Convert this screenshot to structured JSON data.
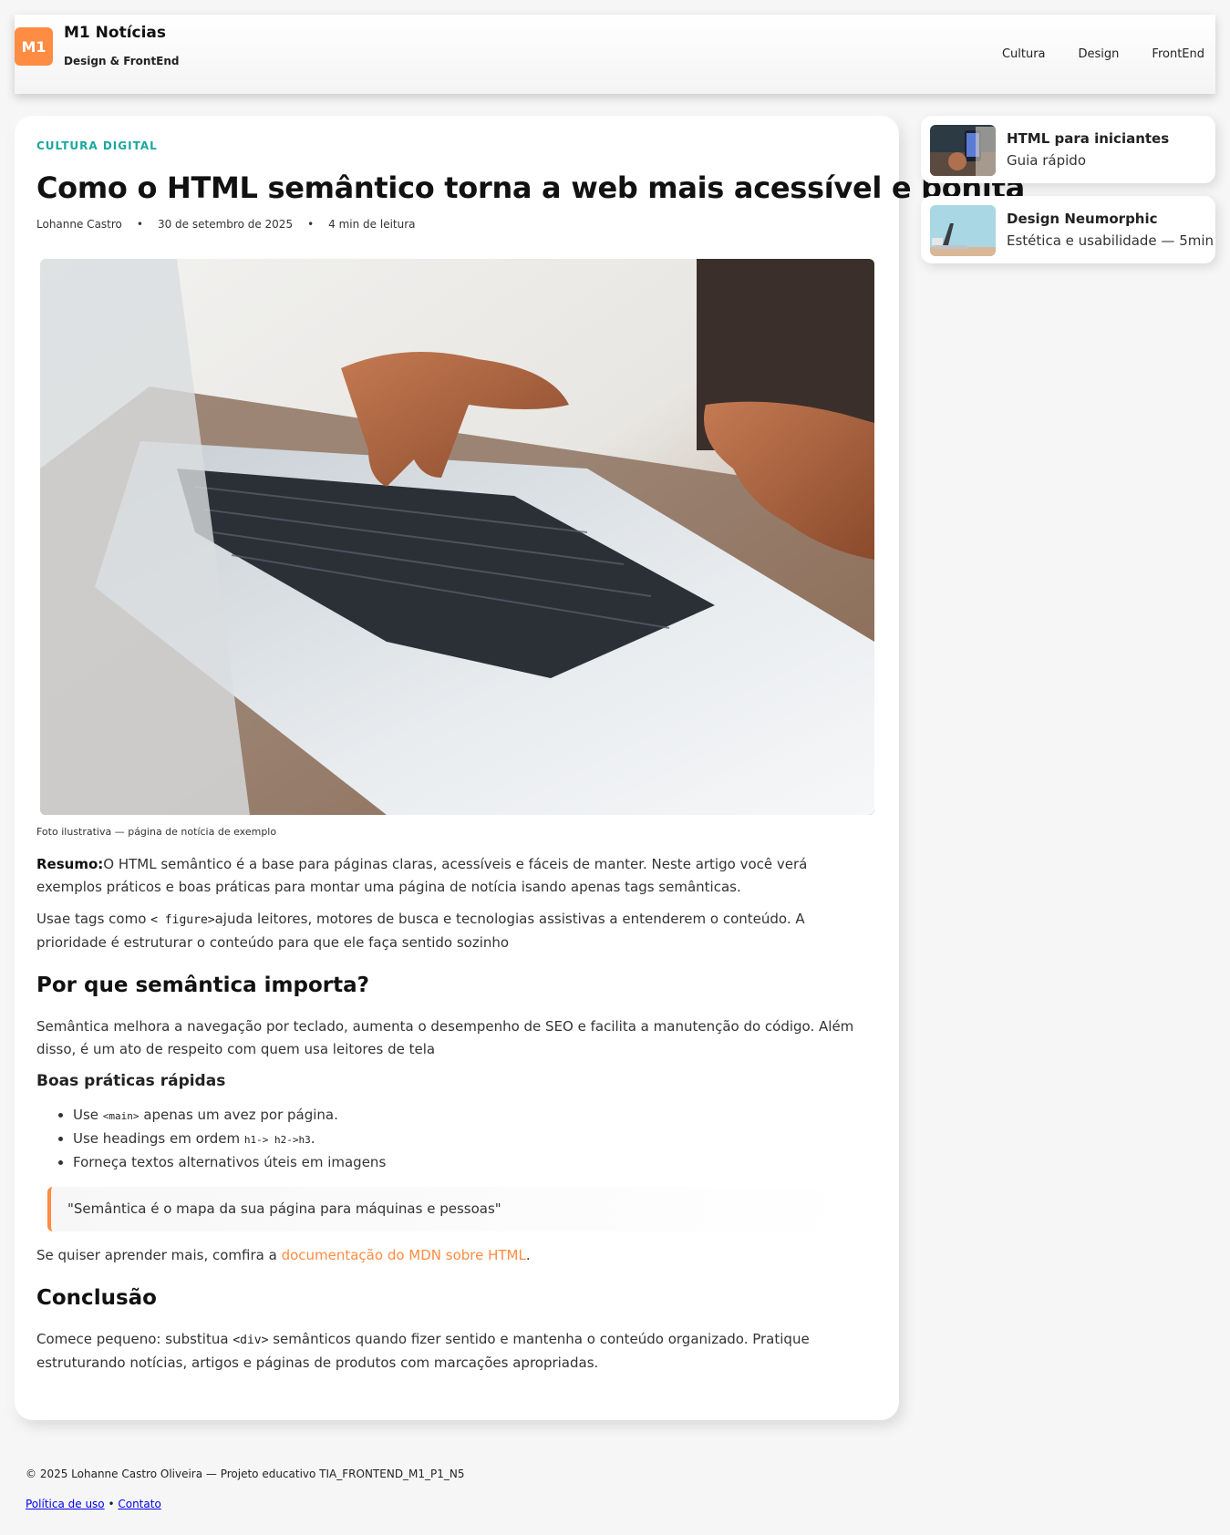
{
  "header": {
    "logo": "M1",
    "title": "M1 Notícias",
    "subtitle": "Design & FrontEnd",
    "nav": [
      "Cultura",
      "Design",
      "FrontEnd"
    ]
  },
  "article": {
    "kicker": "CULTURA DIGITAL",
    "title": "Como o HTML semântico torna a web mais acessível e bonita",
    "author": "Lohanne Castro",
    "date": "30 de setembro de 2025",
    "read_time": "4 min de leitura",
    "separator": "•",
    "caption": "Foto ilustrativa — página de notícia de exemplo",
    "summary_label": "Resumo:",
    "summary_text": "O HTML semântico é a base para páginas claras, acessíveis e fáceis de manter. Neste artigo você verá exemplos práticos e boas práticas para montar uma página de notícia isando apenas tags semânticas.",
    "p2_before": "Usae tags como ",
    "p2_code": "< figure>",
    "p2_after": "ajuda leitores, motores de busca e tecnologias assistivas a entenderem o conteúdo. A prioridade é estruturar o conteúdo para que ele faça sentido sozinho",
    "h2_why": "Por que semântica importa?",
    "p_why": "Semântica melhora a navegação por teclado, aumenta o desempenho de SEO e facilita a manutenção do código. Além disso, é um ato de respeito com quem usa leitores de tela",
    "h3_tips": "Boas práticas rápidas",
    "tips": {
      "t1_before": "Use ",
      "t1_code": "<main>",
      "t1_after": " apenas um avez por página.",
      "t2_before": "Use headings em ordem ",
      "t2_code": "h1-> h2->h3",
      "t2_after": ".",
      "t3": "Forneça textos alternativos úteis em imagens"
    },
    "quote": "\"Semântica é o mapa da sua página para máquinas e pessoas\"",
    "mdn_before": "Se quiser aprender mais, comfira a ",
    "mdn_link": "documentação do MDN sobre HTML",
    "mdn_after": ".",
    "h2_conclusion": "Conclusão",
    "conclusion_before": "Comece pequeno: substitua ",
    "conclusion_code": "<div>",
    "conclusion_after": " semânticos quando fizer sentido e mantenha o conteúdo organizado. Pratique estruturando notícias, artigos e páginas de produtos com marcações apropriadas."
  },
  "sidebar": [
    {
      "title": "HTML para iniciantes",
      "subtitle": "Guia rápido"
    },
    {
      "title": "Design Neumorphic",
      "subtitle": "Estética e usabilidade — 5min"
    }
  ],
  "footer": {
    "copyright": "© 2025 Lohanne Castro Oliveira — Projeto educativo TIA_FRONTEND_M1_P1_N5",
    "link1": "Política de uso",
    "sep": " • ",
    "link2": "Contato"
  },
  "colors": {
    "accent": "#ff8c42",
    "kicker": "#1aa6a0"
  }
}
